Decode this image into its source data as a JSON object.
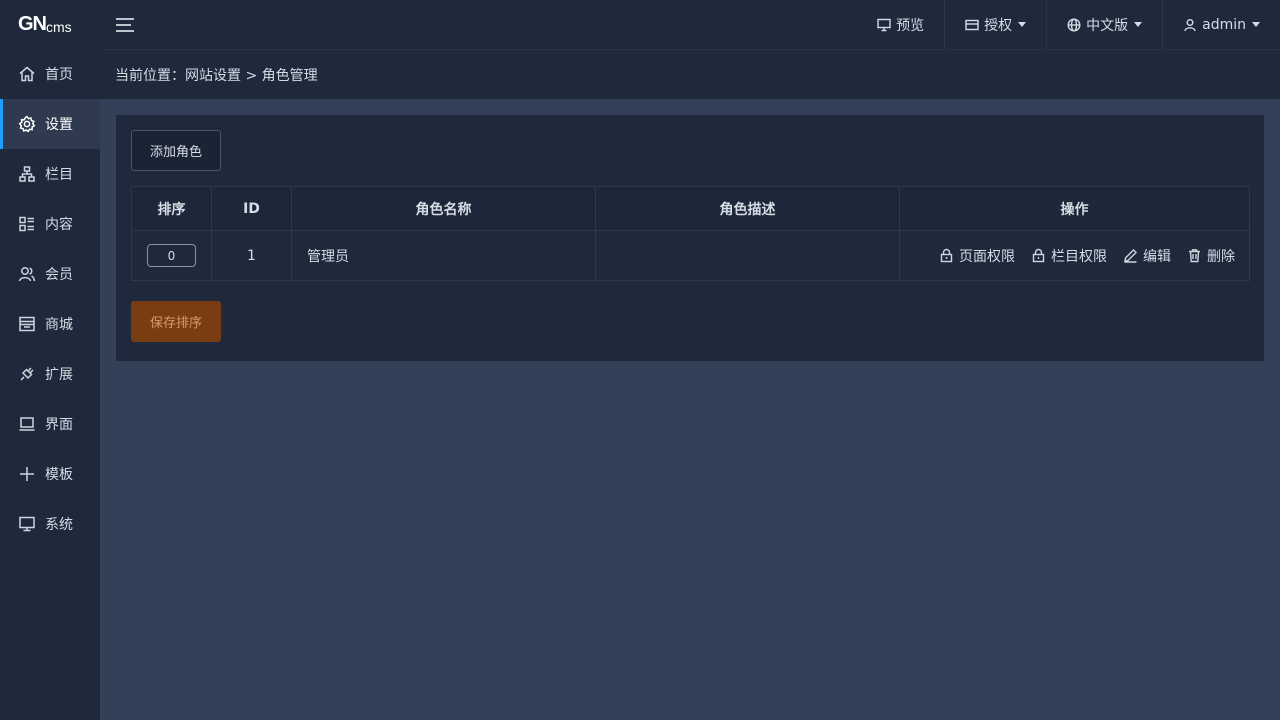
{
  "logo": {
    "big": "GN",
    "small": "cms"
  },
  "sidebar": {
    "items": [
      {
        "label": "首页",
        "icon": "home-icon"
      },
      {
        "label": "设置",
        "icon": "gear-icon",
        "active": true
      },
      {
        "label": "栏目",
        "icon": "sitemap-icon"
      },
      {
        "label": "内容",
        "icon": "list-icon"
      },
      {
        "label": "会员",
        "icon": "users-icon"
      },
      {
        "label": "商城",
        "icon": "store-icon"
      },
      {
        "label": "扩展",
        "icon": "plugin-icon"
      },
      {
        "label": "界面",
        "icon": "laptop-icon"
      },
      {
        "label": "模板",
        "icon": "plus-icon"
      },
      {
        "label": "系统",
        "icon": "monitor-icon"
      }
    ]
  },
  "header": {
    "preview": "预览",
    "license": "授权",
    "language": "中文版",
    "user": "admin"
  },
  "breadcrumb": "当前位置：网站设置 > 角色管理",
  "panel": {
    "add_button": "添加角色",
    "save_button": "保存排序",
    "columns": [
      "排序",
      "ID",
      "角色名称",
      "角色描述",
      "操作"
    ],
    "rows": [
      {
        "sort": "0",
        "id": "1",
        "name": "管理员",
        "description": "",
        "actions": [
          "页面权限",
          "栏目权限",
          "编辑",
          "删除"
        ]
      }
    ]
  },
  "colors": {
    "accent": "#1e9fff",
    "save": "#7a3c12",
    "sidebar": "#1e2a3c",
    "body": "#343f58"
  }
}
